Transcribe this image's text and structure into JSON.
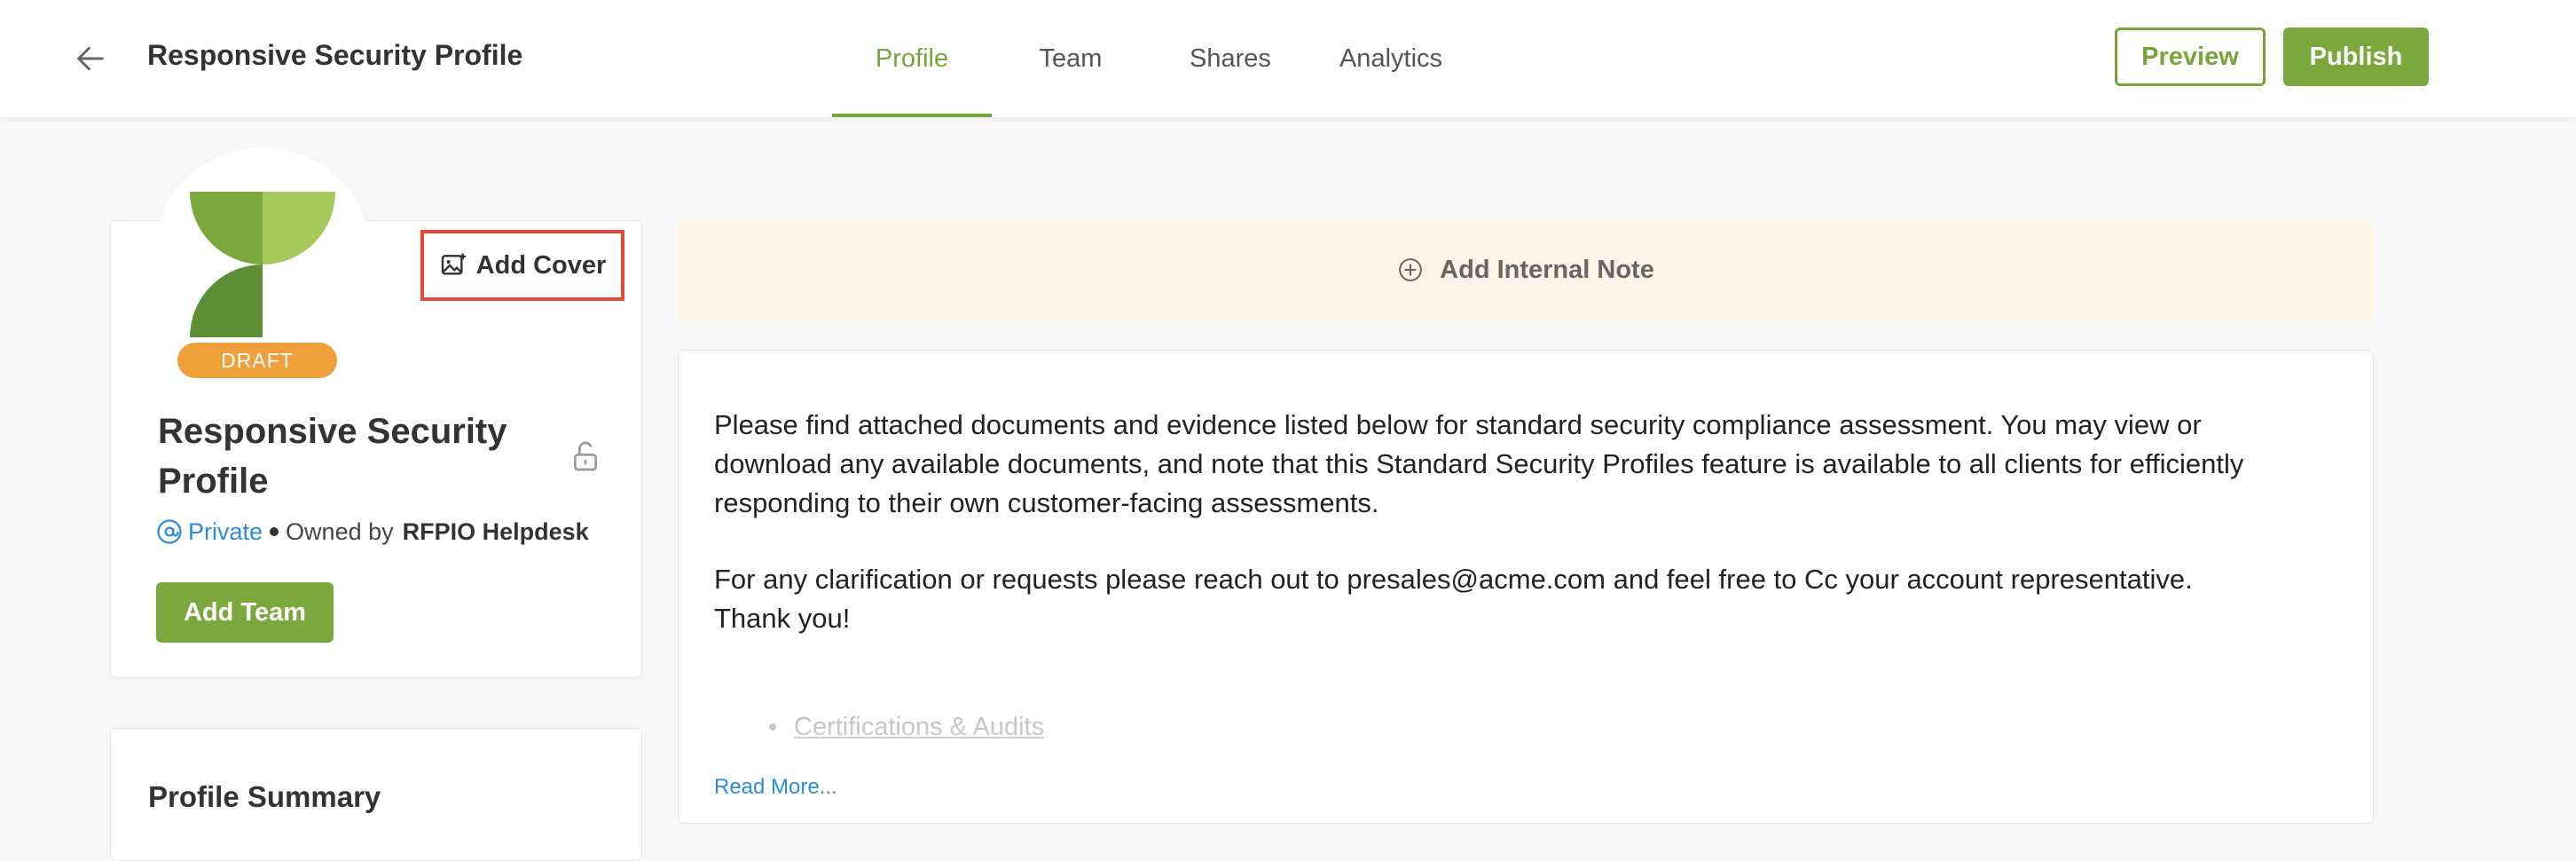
{
  "header": {
    "back_icon": "arrow-left-icon",
    "title": "Responsive Security Profile",
    "tabs": [
      {
        "label": "Profile",
        "active": true
      },
      {
        "label": "Team",
        "active": false
      },
      {
        "label": "Shares",
        "active": false
      },
      {
        "label": "Analytics",
        "active": false
      }
    ],
    "preview_label": "Preview",
    "publish_label": "Publish"
  },
  "profile_card": {
    "status_badge": "DRAFT",
    "add_cover_label": "Add Cover",
    "add_cover_icon": "image-add-icon",
    "name": "Responsive Security Profile",
    "lock_icon": "unlock-icon",
    "visibility": "Private",
    "visibility_icon": "private-at-icon",
    "owned_by_label": "Owned by",
    "owner": "RFPIO Helpdesk",
    "add_team_label": "Add Team"
  },
  "summary_card": {
    "title": "Profile Summary"
  },
  "internal_note": {
    "label": "Add Internal Note",
    "icon": "plus-circle-icon"
  },
  "description": {
    "paragraph_1": "Please find attached documents and evidence listed below for standard security compliance assessment. You may view or download any available documents, and note that this Standard Security Profiles feature is available to all clients for efficiently responding to their own customer-facing assessments.",
    "paragraph_2": "For any clarification or requests please reach out to presales@acme.com and feel free to Cc your account representative.",
    "paragraph_3": "Thank you!",
    "list_items": [
      "Certifications & Audits"
    ],
    "read_more_label": "Read More..."
  },
  "colors": {
    "brand_green": "#7aa83d",
    "draft_orange": "#f0a03b",
    "highlight_red": "#e04a36",
    "link_blue": "#2b8be0",
    "note_bg": "#fdf4e9"
  }
}
